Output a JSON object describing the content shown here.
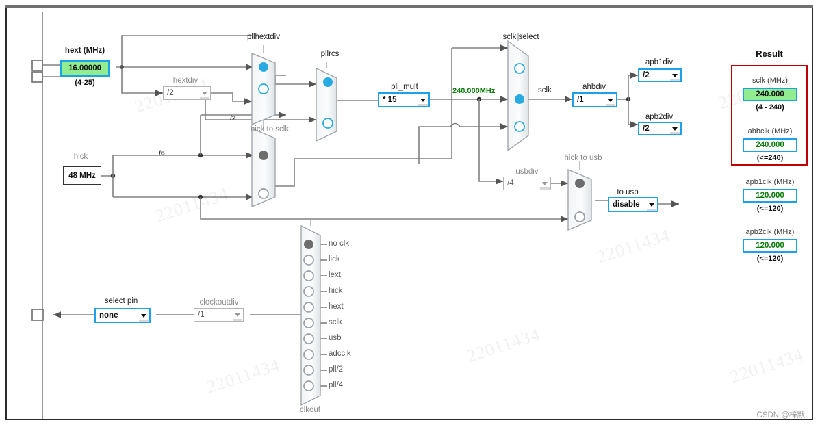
{
  "window": {
    "footer_credit": "CSDN @梓默"
  },
  "watermark": {
    "text": "22011434"
  },
  "inputs": {
    "hext": {
      "label": "hext (MHz)",
      "value": "16.00000",
      "range": "(4-25)"
    },
    "hick": {
      "label": "hick",
      "value": "48 MHz"
    },
    "hick_div_label": "/6",
    "hextdiv_out_label": "/2"
  },
  "dividers": {
    "hextdiv": {
      "label": "hextdiv",
      "value": "/2",
      "enabled": false
    },
    "pll_mult": {
      "label": "pll_mult",
      "value": "* 15",
      "enabled": true
    },
    "ahbdiv": {
      "label": "ahbdiv",
      "value": "/1",
      "enabled": true
    },
    "apb1div": {
      "label": "apb1div",
      "value": "/2",
      "enabled": true
    },
    "apb2div": {
      "label": "apb2div",
      "value": "/2",
      "enabled": true
    },
    "usbdiv": {
      "label": "usbdiv",
      "value": "/4",
      "enabled": false
    },
    "clockoutdiv": {
      "label": "clockoutdiv",
      "value": "/1",
      "enabled": false
    }
  },
  "selects": {
    "to_usb": {
      "label": "to usb",
      "value": "disable",
      "enabled": true
    },
    "select_pin": {
      "label": "select pin",
      "value": "none",
      "enabled": true
    }
  },
  "muxes": {
    "pllhextdiv": {
      "label": "pllhextdiv",
      "selected_index": 0,
      "options": 2,
      "style": "blue"
    },
    "pllrcs": {
      "label": "pllrcs",
      "selected_index": 0,
      "options": 2,
      "style": "blue"
    },
    "hick_to_sclk": {
      "label": "hick to sclk",
      "selected_index": 0,
      "options": 2,
      "style": "grey"
    },
    "sclk_select": {
      "label": "sclk select",
      "selected_index": 1,
      "options": 3,
      "style": "blue"
    },
    "hick_to_usb": {
      "label": "hick to usb",
      "selected_index": 0,
      "options": 2,
      "style": "grey"
    },
    "clkout": {
      "label": "clkout",
      "selected_index": 0,
      "options": [
        "no clk",
        "lick",
        "lext",
        "hick",
        "hext",
        "sclk",
        "usb",
        "adcclk",
        "pll/2",
        "pll/4"
      ]
    }
  },
  "nets": {
    "pll_output": "240.000MHz",
    "sclk": "sclk"
  },
  "result": {
    "title": "Result",
    "items": [
      {
        "label": "sclk (MHz)",
        "value": "240.000",
        "limit": "(4 - 240)",
        "highlight": true
      },
      {
        "label": "ahbclk (MHz)",
        "value": "240.000",
        "limit": "(<=240)",
        "highlight": false
      },
      {
        "label": "apb1clk (MHz)",
        "value": "120.000",
        "limit": "(<=120)",
        "highlight": false
      },
      {
        "label": "apb2clk (MHz)",
        "value": "120.000",
        "limit": "(<=120)",
        "highlight": false
      }
    ]
  },
  "colors": {
    "accent_blue": "#1da1e8",
    "highlight_green": "#90ee90",
    "value_green": "#0a7d0a",
    "result_border_red": "#c00000",
    "wire_grey": "#808080"
  }
}
